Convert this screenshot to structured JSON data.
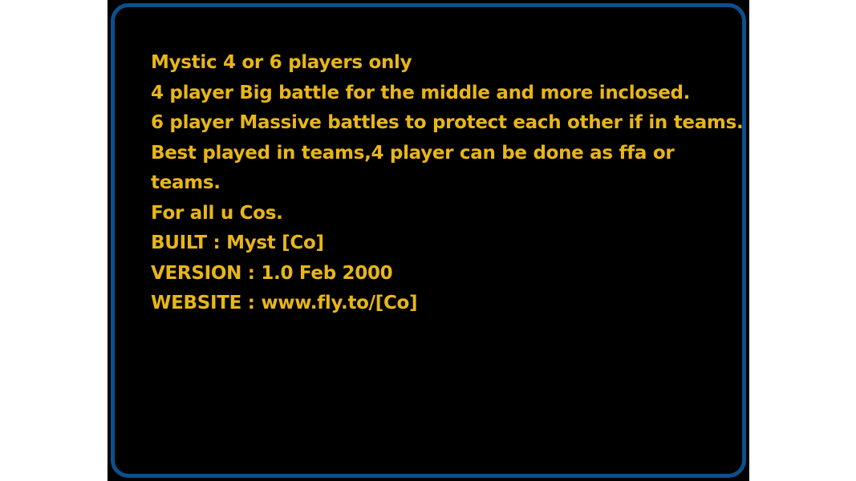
{
  "map_info": {
    "lines": [
      "Mystic 4 or 6 players only",
      "4 player Big battle for the middle and more inclosed.",
      "6 player Massive battles to protect each other if in teams.",
      "Best played in teams,4 player can be done as ffa or",
      "teams.",
      "For all u Cos.",
      "BUILT : Myst [Co]",
      "VERSION : 1.0  Feb 2000",
      "WEBSITE : www.fly.to/[Co]"
    ]
  },
  "colors": {
    "background": "#000000",
    "border": "#0d4f8c",
    "text": "#e8b618",
    "page": "#ffffff"
  }
}
